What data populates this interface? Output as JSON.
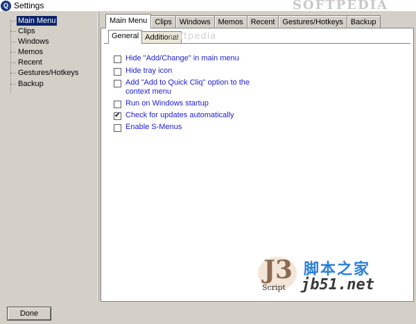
{
  "window": {
    "title": "Settings",
    "app_icon_letter": "Q"
  },
  "watermarks": {
    "top": "SOFTPEDIA",
    "mid": "softpedia"
  },
  "tree": {
    "items": [
      {
        "label": "Main Menu",
        "selected": true
      },
      {
        "label": "Clips"
      },
      {
        "label": "Windows"
      },
      {
        "label": "Memos"
      },
      {
        "label": "Recent"
      },
      {
        "label": "Gestures/Hotkeys"
      },
      {
        "label": "Backup"
      }
    ]
  },
  "tabs": [
    {
      "label": "Main Menu",
      "active": true
    },
    {
      "label": "Clips"
    },
    {
      "label": "Windows"
    },
    {
      "label": "Memos"
    },
    {
      "label": "Recent"
    },
    {
      "label": "Gestures/Hotkeys"
    },
    {
      "label": "Backup"
    }
  ],
  "subtabs": [
    {
      "label": "General",
      "active": true
    },
    {
      "label": "Additional"
    }
  ],
  "options": [
    {
      "label": "Hide \"Add/Change\" in main menu",
      "checked": false
    },
    {
      "label": "Hide tray icon",
      "checked": false
    },
    {
      "label": "Add \"Add to Quick Cliq\" option to the context menu",
      "checked": false
    },
    {
      "label": "Run on Windows startup",
      "checked": false
    },
    {
      "label": "Check for updates automatically",
      "checked": true
    },
    {
      "label": "Enable S-Menus",
      "checked": false
    }
  ],
  "logo": {
    "mark": "J3",
    "script": "Script",
    "cn": "脚本之家",
    "url": "jb51.net"
  },
  "footer": {
    "done_label": "Done"
  },
  "colors": {
    "selection": "#0a246a",
    "option_text": "#1b1bd6",
    "chrome": "#d4d0c8"
  }
}
